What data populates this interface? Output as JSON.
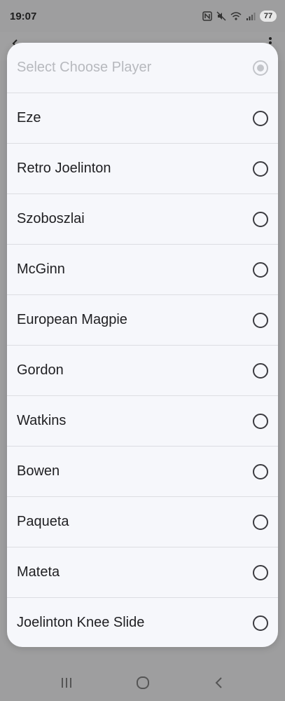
{
  "status_bar": {
    "time": "19:07",
    "battery": "77",
    "icons": [
      "nfc-icon",
      "mute-icon",
      "wifi-icon",
      "signal-icon",
      "battery-icon"
    ]
  },
  "dialog": {
    "title": "Select Choose Player",
    "options": [
      {
        "label": "Eze"
      },
      {
        "label": "Retro Joelinton"
      },
      {
        "label": "Szoboszlai"
      },
      {
        "label": "McGinn"
      },
      {
        "label": "European Magpie"
      },
      {
        "label": "Gordon"
      },
      {
        "label": "Watkins"
      },
      {
        "label": "Bowen"
      },
      {
        "label": "Paqueta"
      },
      {
        "label": "Mateta"
      },
      {
        "label": "Joelinton Knee Slide"
      }
    ]
  },
  "nav_bar": {
    "buttons": [
      "recent-apps-icon",
      "home-icon",
      "back-icon"
    ]
  },
  "colors": {
    "dim_background": "#9e9e9f",
    "dialog_background": "#f6f7fb",
    "divider": "#dcdde2",
    "title_disabled": "#b7b9be"
  }
}
